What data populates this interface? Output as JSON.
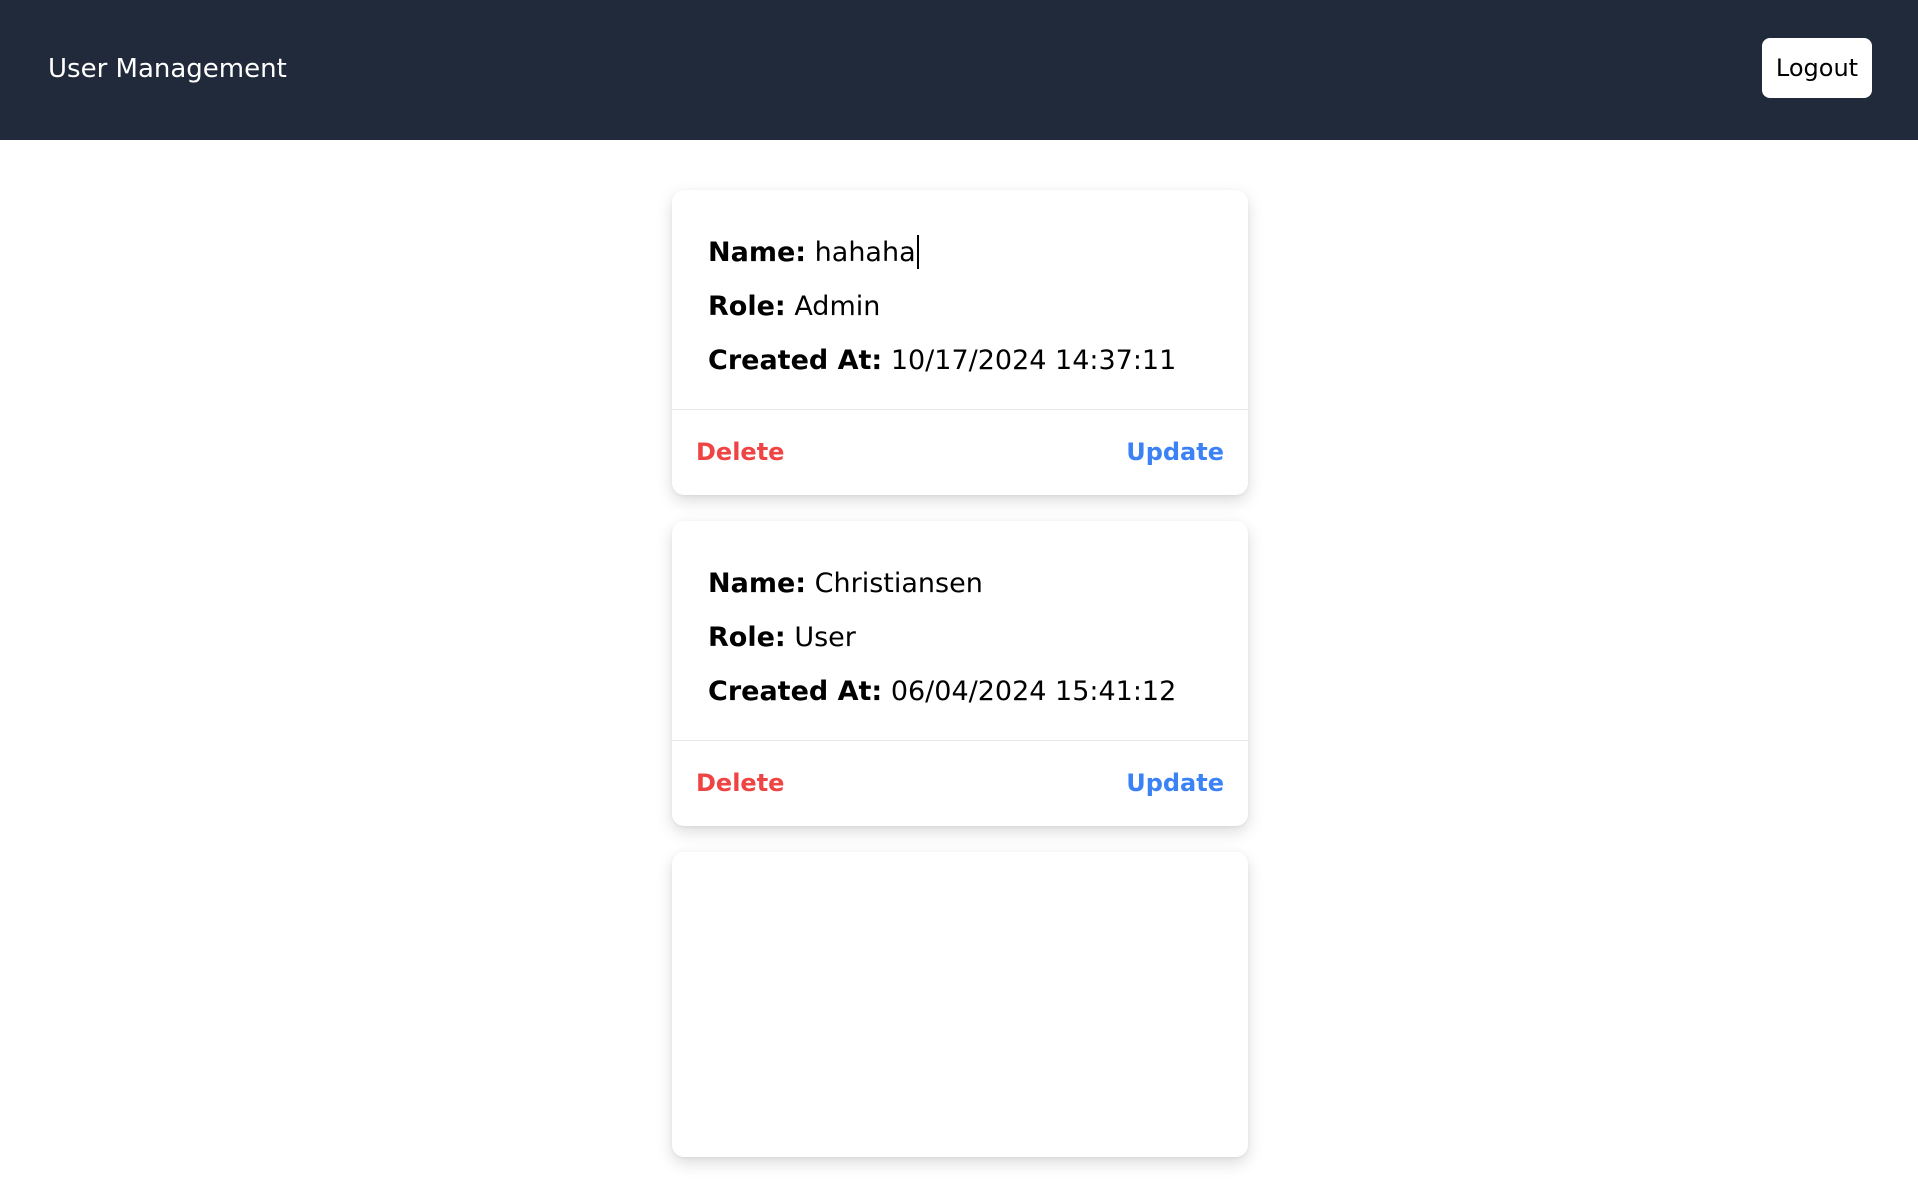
{
  "header": {
    "title": "User Management",
    "logout_label": "Logout"
  },
  "labels": {
    "name": "Name:",
    "role": "Role:",
    "created_at": "Created At:",
    "delete": "Delete",
    "update": "Update"
  },
  "users": [
    {
      "name": "hahaha",
      "role": "Admin",
      "created_at": "10/17/2024 14:37:11"
    },
    {
      "name": "Christiansen",
      "role": "User",
      "created_at": "06/04/2024 15:41:12"
    },
    {
      "name": "",
      "role": "",
      "created_at": ""
    }
  ],
  "colors": {
    "header_bg": "#212a3a",
    "delete": "#ef4444",
    "update": "#3b82f6"
  }
}
